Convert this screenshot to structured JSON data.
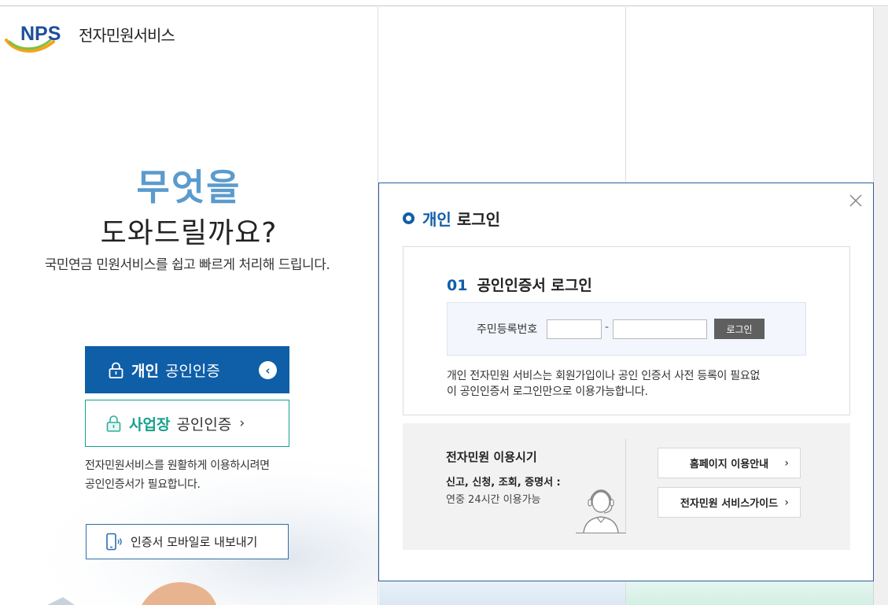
{
  "logo": {
    "brand": "NPS",
    "service": "전자민원서비스"
  },
  "hero": {
    "headline": "무엇을",
    "subheadline": "도와드릴까요?",
    "description": "국민연금 민원서비스를 쉽고 빠르게 처리해 드립니다."
  },
  "auth": {
    "personal_bold": "개인",
    "personal_rest": "공인인증",
    "business_bold": "사업장",
    "business_rest": "공인인증",
    "business_arrow": "›",
    "note_line1": "전자민원서비스를 원활하게 이용하시려면",
    "note_line2": "공인인증서가 필요합니다.",
    "mobile_bold": "인증서 모바일로",
    "mobile_rest": " 내보내기"
  },
  "modal": {
    "title_accent": "개인",
    "title_rest": "로그인",
    "step_num": "01",
    "step_title": "공인인증서 로그인",
    "rrn_label": "주민등록번호",
    "rrn_first": "",
    "rrn_second": "",
    "dash": "-",
    "login_button": "로그인",
    "desc_line1": "개인 전자민원 서비스는 회원가입이나 공인 인증서 사전 등록이 필요없",
    "desc_line2": "이 공인인증서 로그인만으로 이용가능합니다.",
    "hours_title": "전자민원 이용시기",
    "hours_sub": "신고, 신청, 조회, 증명서 :",
    "hours_value": "연중 24시간 이용가능",
    "guide_home": "홈페이지 이용안내",
    "guide_service": "전자민원 서비스가이드",
    "guide_arrow": "›"
  },
  "colors": {
    "primary": "#0f5ea8",
    "teal": "#17a08b",
    "hero_blue": "#5b9bcd",
    "login_button_bg": "#5f5f5f"
  }
}
